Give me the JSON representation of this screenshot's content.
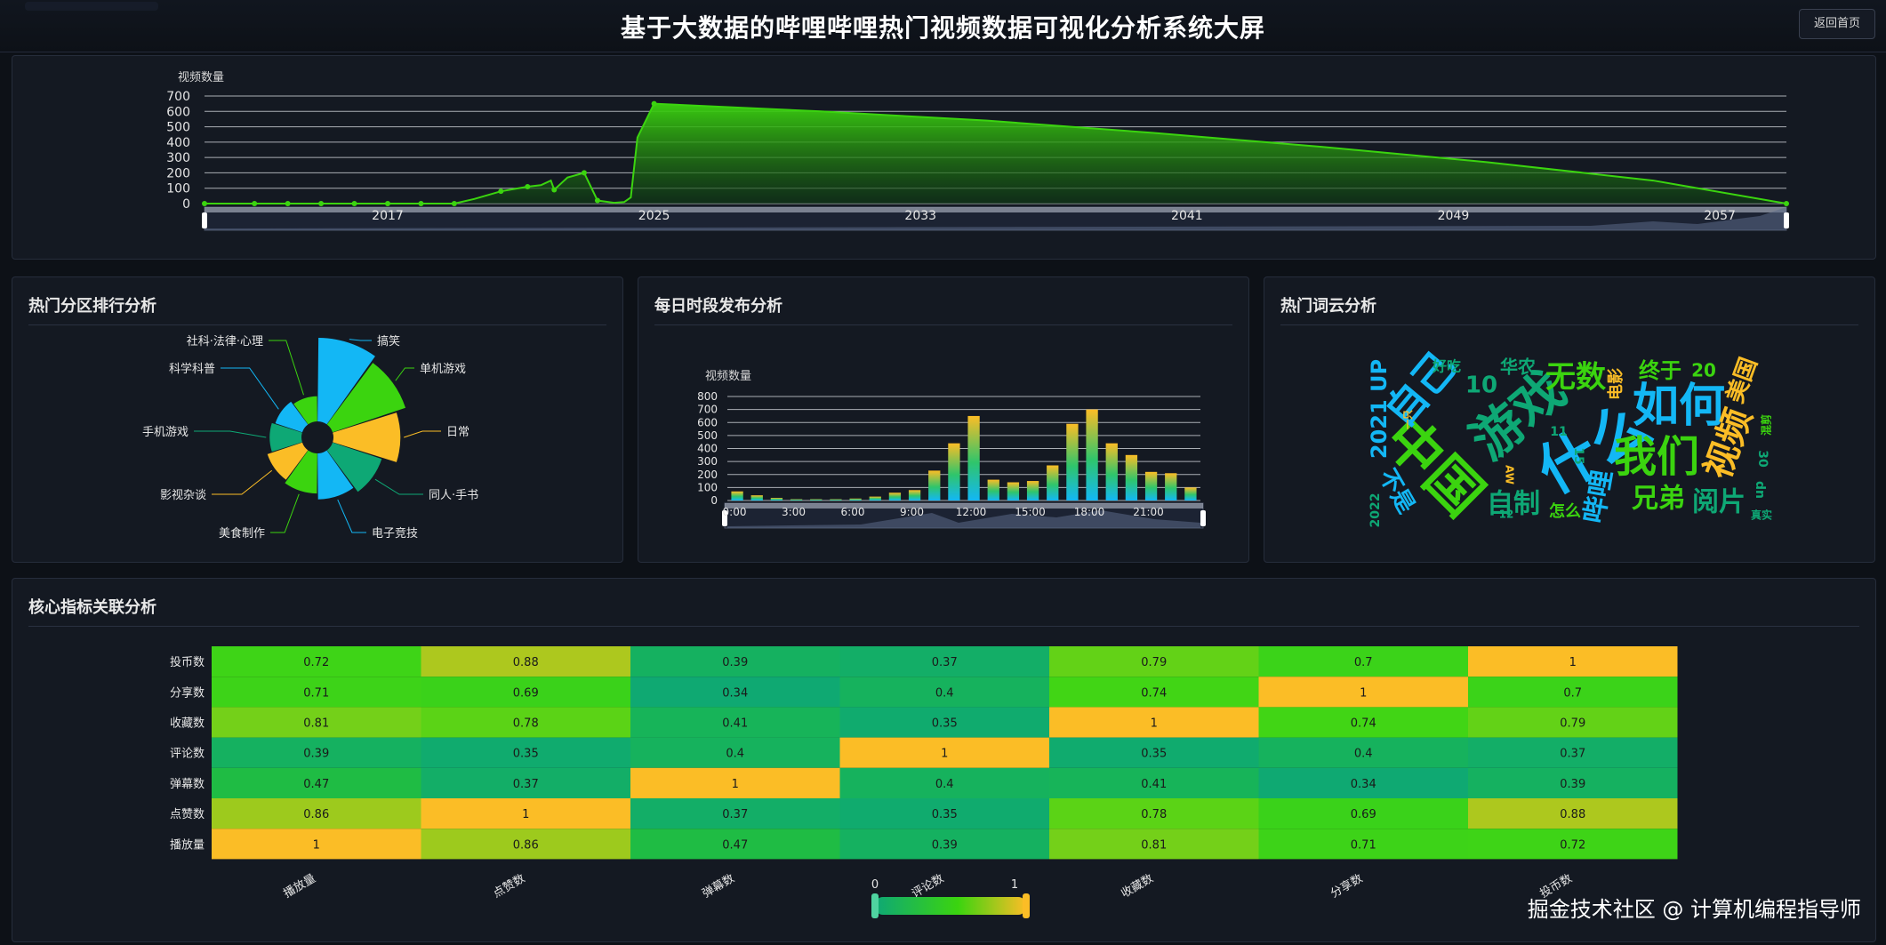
{
  "header": {
    "title": "基于大数据的哔哩哔哩热门视频数据可视化分析系统大屏",
    "home_button": "返回首页"
  },
  "panels": {
    "category": "热门分区排行分析",
    "hourly": "每日时段发布分析",
    "wordcloud": "热门词云分析",
    "correlation": "核心指标关联分析"
  },
  "watermark": "掘金技术社区 @ 计算机编程指导师",
  "colors": {
    "green": "#3bd40f",
    "cyan": "#13b7f5",
    "orange": "#fbbd26",
    "teal": "#0ea875",
    "panel": "#141922"
  },
  "chart_data": [
    {
      "type": "area",
      "id": "yearly",
      "ylabel": "视频数量",
      "ylim": [
        0,
        700
      ],
      "yticks": [
        0,
        100,
        200,
        300,
        400,
        500,
        600,
        700
      ],
      "xticks": [
        "2017",
        "2025",
        "2033",
        "2041",
        "2049",
        "2057"
      ],
      "x": [
        2011.5,
        2015,
        2019,
        2019.6,
        2020.4,
        2021.2,
        2021.6,
        2021.9,
        2022.0,
        2022.4,
        2022.9,
        2023.3,
        2023.8,
        2024.1,
        2024.3,
        2024.5,
        2025,
        2030,
        2035,
        2040,
        2045,
        2050,
        2055,
        2059
      ],
      "y": [
        0,
        0,
        0,
        30,
        80,
        110,
        120,
        150,
        90,
        170,
        200,
        20,
        5,
        10,
        40,
        430,
        650,
        600,
        540,
        460,
        370,
        270,
        150,
        0
      ],
      "points_x": [
        2011.5,
        2013,
        2014,
        2015,
        2016,
        2017,
        2018,
        2019,
        2020.4,
        2021.2,
        2022.0,
        2022.9,
        2023.3,
        2025,
        2059
      ],
      "points_y": [
        0,
        0,
        0,
        0,
        0,
        0,
        0,
        0,
        80,
        110,
        90,
        200,
        20,
        650,
        0
      ],
      "grid": true
    },
    {
      "type": "pie",
      "id": "category",
      "rose": true,
      "labels": [
        "搞笑",
        "单机游戏",
        "日常",
        "同人·手书",
        "电子竞技",
        "美食制作",
        "影视杂谈",
        "手机游戏",
        "科学科普",
        "社科·法律·心理"
      ],
      "values": [
        100,
        92,
        80,
        62,
        55,
        48,
        44,
        38,
        34,
        30
      ],
      "colors": [
        "#13b7f5",
        "#3bd40f",
        "#fbbd26",
        "#0ea875",
        "#13b7f5",
        "#3bd40f",
        "#fbbd26",
        "#0ea875",
        "#13b7f5",
        "#3bd40f"
      ]
    },
    {
      "type": "bar",
      "id": "hourly",
      "ylabel": "视频数量",
      "ylim": [
        0,
        800
      ],
      "yticks": [
        0,
        100,
        200,
        300,
        400,
        500,
        600,
        700,
        800
      ],
      "xticks": [
        "0:00",
        "3:00",
        "6:00",
        "9:00",
        "12:00",
        "15:00",
        "18:00",
        "21:00"
      ],
      "categories": [
        "0:00",
        "1:00",
        "2:00",
        "3:00",
        "4:00",
        "5:00",
        "6:00",
        "7:00",
        "8:00",
        "9:00",
        "10:00",
        "11:00",
        "12:00",
        "13:00",
        "14:00",
        "15:00",
        "16:00",
        "17:00",
        "18:00",
        "19:00",
        "20:00",
        "21:00",
        "22:00",
        "23:00"
      ],
      "values": [
        70,
        40,
        20,
        10,
        10,
        10,
        15,
        30,
        60,
        80,
        230,
        440,
        650,
        160,
        140,
        150,
        270,
        590,
        700,
        440,
        350,
        220,
        210,
        100
      ]
    },
    {
      "type": "heatmap",
      "id": "correlation",
      "x_categories": [
        "播放量",
        "点赞数",
        "弹幕数",
        "评论数",
        "收藏数",
        "分享数",
        "投币数"
      ],
      "y_categories": [
        "投币数",
        "分享数",
        "收藏数",
        "评论数",
        "弹幕数",
        "点赞数",
        "播放量"
      ],
      "values": [
        [
          0.72,
          0.88,
          0.39,
          0.37,
          0.79,
          0.7,
          1
        ],
        [
          0.71,
          0.69,
          0.34,
          0.4,
          0.74,
          1,
          0.7
        ],
        [
          0.81,
          0.78,
          0.41,
          0.35,
          1,
          0.74,
          0.79
        ],
        [
          0.39,
          0.35,
          0.4,
          1,
          0.35,
          0.4,
          0.37
        ],
        [
          0.47,
          0.37,
          1,
          0.4,
          0.41,
          0.34,
          0.39
        ],
        [
          0.86,
          1,
          0.37,
          0.35,
          0.78,
          0.69,
          0.88
        ],
        [
          1,
          0.86,
          0.47,
          0.39,
          0.81,
          0.71,
          0.72
        ]
      ],
      "visual_map": {
        "min": "0",
        "max": "1"
      }
    }
  ],
  "wordcloud": {
    "words": [
      {
        "text": "什么",
        "size": 66,
        "color": "#13b7f5",
        "x": 1795,
        "y": 508,
        "rot": -30
      },
      {
        "text": "中国",
        "size": 62,
        "color": "#3bd40f",
        "x": 1610,
        "y": 528,
        "rot": 45
      },
      {
        "text": "游戏",
        "size": 58,
        "color": "#0ea875",
        "x": 1710,
        "y": 470,
        "rot": -40
      },
      {
        "text": "如何",
        "size": 52,
        "color": "#13b7f5",
        "x": 1888,
        "y": 460,
        "rot": 0
      },
      {
        "text": "我们",
        "size": 48,
        "color": "#3bd40f",
        "x": 1863,
        "y": 517,
        "rot": 0
      },
      {
        "text": "自己",
        "size": 46,
        "color": "#13b7f5",
        "x": 1600,
        "y": 440,
        "rot": -50
      },
      {
        "text": "视频",
        "size": 40,
        "color": "#fbbd26",
        "x": 1946,
        "y": 500,
        "rot": -70
      },
      {
        "text": "无数",
        "size": 34,
        "color": "#3bd40f",
        "x": 1772,
        "y": 426,
        "rot": 0
      },
      {
        "text": "兄弟",
        "size": 30,
        "color": "#3bd40f",
        "x": 1865,
        "y": 562,
        "rot": 0
      },
      {
        "text": "阅片",
        "size": 30,
        "color": "#0ea875",
        "x": 1933,
        "y": 566,
        "rot": 0
      },
      {
        "text": "哔哩",
        "size": 30,
        "color": "#13b7f5",
        "x": 1799,
        "y": 559,
        "rot": -80
      },
      {
        "text": "自制",
        "size": 30,
        "color": "#0ea875",
        "x": 1702,
        "y": 568,
        "rot": 0
      },
      {
        "text": "2021 UP",
        "size": 24,
        "color": "#13b7f5",
        "x": 1552,
        "y": 460,
        "rot": -90
      },
      {
        "text": "10",
        "size": 26,
        "color": "#0ea875",
        "x": 1666,
        "y": 434,
        "rot": 0
      },
      {
        "text": "终于",
        "size": 24,
        "color": "#3bd40f",
        "x": 1867,
        "y": 418,
        "rot": 0
      },
      {
        "text": "20",
        "size": 20,
        "color": "#3bd40f",
        "x": 1916,
        "y": 418,
        "rot": 0
      },
      {
        "text": "美国",
        "size": 26,
        "color": "#fbbd26",
        "x": 1960,
        "y": 428,
        "rot": -70
      },
      {
        "text": "电影",
        "size": 18,
        "color": "#fbbd26",
        "x": 1818,
        "y": 432,
        "rot": -90
      },
      {
        "text": "华农",
        "size": 20,
        "color": "#0ea875",
        "x": 1707,
        "y": 414,
        "rot": 0
      },
      {
        "text": "好吃",
        "size": 16,
        "color": "#0ea875",
        "x": 1627,
        "y": 413,
        "rot": 0
      },
      {
        "text": "不是",
        "size": 26,
        "color": "#13b7f5",
        "x": 1570,
        "y": 553,
        "rot": 60
      },
      {
        "text": "2022",
        "size": 14,
        "color": "#0ea875",
        "x": 1547,
        "y": 574,
        "rot": -90
      },
      {
        "text": "怎么",
        "size": 18,
        "color": "#3bd40f",
        "x": 1760,
        "y": 576,
        "rot": 0
      },
      {
        "text": "真实",
        "size": 12,
        "color": "#0ea875",
        "x": 1981,
        "y": 580,
        "rot": 0
      },
      {
        "text": "dn",
        "size": 14,
        "color": "#0ea875",
        "x": 1979,
        "y": 551,
        "rot": 90
      },
      {
        "text": "30",
        "size": 14,
        "color": "#0ea875",
        "x": 1982,
        "y": 516,
        "rot": 90
      },
      {
        "text": "混剪",
        "size": 12,
        "color": "#3bd40f",
        "x": 1987,
        "y": 478,
        "rot": -90
      },
      {
        "text": "11",
        "size": 14,
        "color": "#0ea875",
        "x": 1753,
        "y": 486,
        "rot": 0
      },
      {
        "text": "15",
        "size": 14,
        "color": "#0ea875",
        "x": 1775,
        "y": 513,
        "rot": 90
      },
      {
        "text": "一只",
        "size": 11,
        "color": "#fbbd26",
        "x": 1584,
        "y": 472,
        "rot": -90
      },
      {
        "text": "AW",
        "size": 12,
        "color": "#fbbd26",
        "x": 1697,
        "y": 534,
        "rot": 90
      },
      {
        "text": "12",
        "size": 12,
        "color": "#0ea875",
        "x": 1694,
        "y": 579,
        "rot": 0
      }
    ]
  }
}
